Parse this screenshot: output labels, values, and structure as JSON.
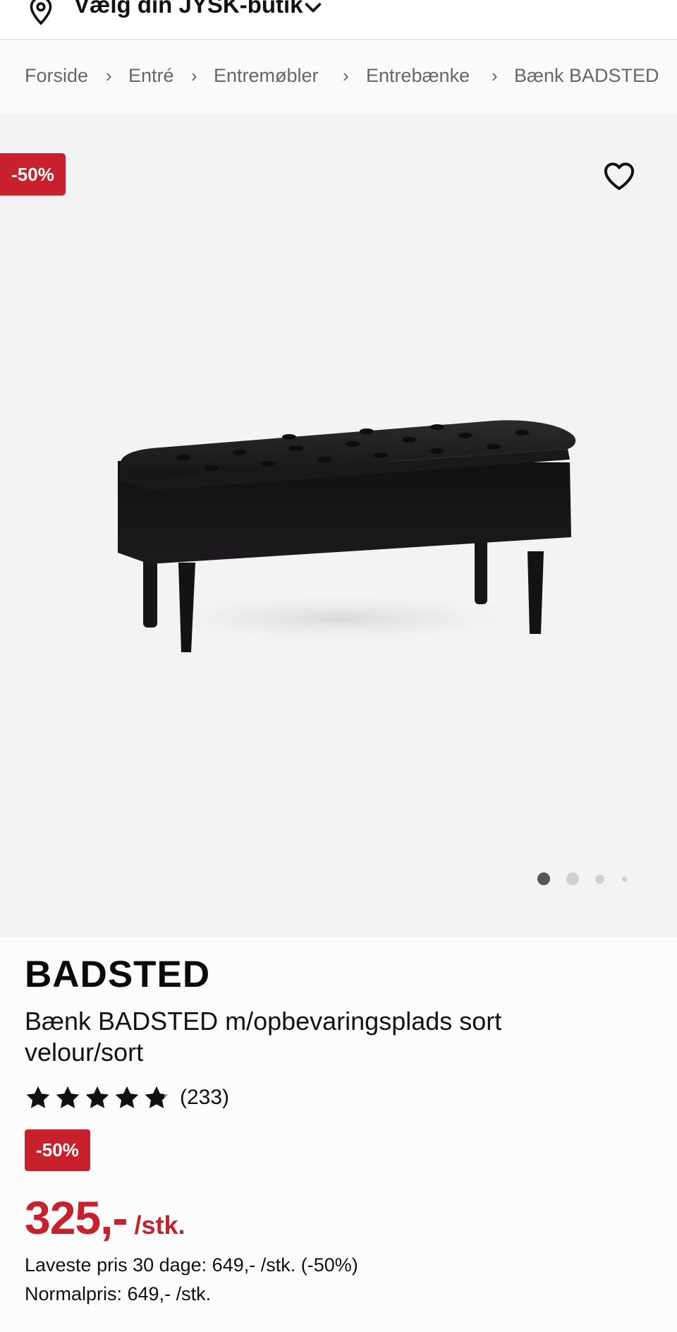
{
  "header": {
    "store_label": "Vælg din JYSK-butik",
    "icons": {
      "pin": "location-pin-icon",
      "chevron": "chevron-down-icon"
    }
  },
  "breadcrumb": {
    "items": [
      "Forside",
      "Entré",
      "Entremøbler",
      "Entrebænke",
      "Bænk BADSTED"
    ],
    "separator": "›"
  },
  "gallery": {
    "discount_badge": "-50%",
    "favorite_icon": "heart-icon",
    "image_alt": "Bænk BADSTED m/opbevaringsplads sort velour/sort",
    "dots_total": 4,
    "active_dot": 1
  },
  "product": {
    "brand_title": "BADSTED",
    "name": "Bænk BADSTED m/opbevaringsplads sort velour/sort",
    "rating": {
      "value": 4.8,
      "max": 5,
      "count": "(233)"
    },
    "discount_badge": "-50%",
    "price": "325,-",
    "unit": "/stk.",
    "lowest_price_30_days": "Laveste pris 30 dage: 649,- /stk. (-50%)",
    "normal_price": "Normalpris: 649,- /stk."
  },
  "colors": {
    "accent_red": "#c8202c",
    "text": "#111111",
    "muted": "#666666",
    "gallery_bg": "#f3f3f3"
  }
}
